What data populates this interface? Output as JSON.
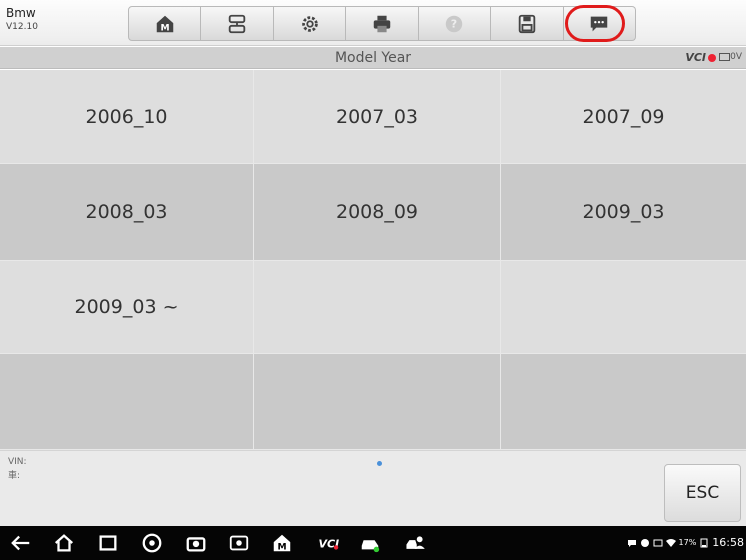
{
  "app": {
    "name": "Bmw",
    "version": "V12.10"
  },
  "toolbar": {
    "buttons": [
      {
        "icon": "home-icon"
      },
      {
        "icon": "vehicle-swap-icon"
      },
      {
        "icon": "settings-icon"
      },
      {
        "icon": "print-icon"
      },
      {
        "icon": "help-icon"
      },
      {
        "icon": "save-icon"
      },
      {
        "icon": "message-icon"
      }
    ],
    "highlight_color": "#e01b1b"
  },
  "titlebar": {
    "title": "Model Year",
    "vci_label": "VCI",
    "voltage": "0V"
  },
  "grid": {
    "cells": [
      "2006_10",
      "2007_03",
      "2007_09",
      "2008_03",
      "2008_09",
      "2009_03",
      "2009_03 ~",
      "",
      "",
      "",
      "",
      ""
    ]
  },
  "footer": {
    "vin_label": "VIN:",
    "car_label": "車:",
    "esc_label": "ESC"
  },
  "navbar": {
    "battery_percent": "17%",
    "time": "16:58"
  },
  "colors": {
    "cell_light": "#dedede",
    "cell_dark": "#c9c9c9",
    "vci_error": "#e23"
  }
}
